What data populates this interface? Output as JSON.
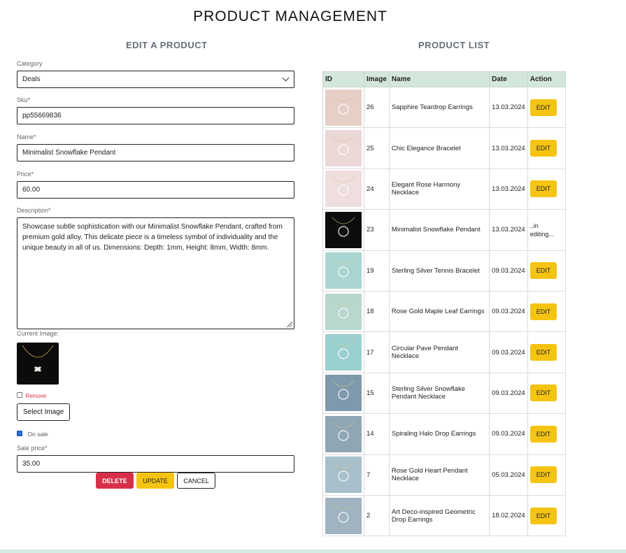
{
  "page": {
    "title": "PRODUCT MANAGEMENT"
  },
  "edit_form": {
    "section_title": "EDIT A PRODUCT",
    "category": {
      "label": "Category",
      "value": "Deals"
    },
    "sku": {
      "label": "Sku*",
      "value": "pp55669836"
    },
    "name": {
      "label": "Name*",
      "value": "Minimalist Snowflake Pendant"
    },
    "price": {
      "label": "Price*",
      "value": "60.00"
    },
    "description": {
      "label": "Description*",
      "value": "Showcase subtle sophistication with our Minimalist Snowflake Pendant, crafted from premium gold alloy. This delicate piece is a timeless symbol of individuality and the unique beauty in all of us. Dimensions: Depth: 1mm, Height: 8mm, Width: 8mm."
    },
    "current_image_label": "Current Image:",
    "remove_label": "Remove",
    "select_image_label": "Select Image",
    "on_sale_label": "On sale",
    "on_sale_checked": true,
    "sale_price": {
      "label": "Sale price*",
      "value": "35.00"
    },
    "buttons": {
      "delete": "DELETE",
      "update": "UPDATE",
      "cancel": "CANCEL"
    }
  },
  "product_list": {
    "section_title": "PRODUCT LIST",
    "columns": [
      "ID",
      "Image",
      "Name",
      "Date",
      "Action"
    ],
    "edit_label": "EDIT",
    "editing_label": "..in editing...",
    "rows": [
      {
        "id": "26",
        "name": "Sapphire Teardrop Earrings",
        "date": "13.03.2024",
        "editing": false,
        "img": "earrings-blue-icon",
        "bg": "#e6cfc7"
      },
      {
        "id": "25",
        "name": "Chic Elegance Bracelet",
        "date": "13.03.2024",
        "editing": false,
        "img": "bracelet-icon",
        "bg": "#ecd7d7"
      },
      {
        "id": "24",
        "name": "Elegant Rose Harmony Necklace",
        "date": "13.03.2024",
        "editing": false,
        "img": "necklace-pink-icon",
        "bg": "#efdede"
      },
      {
        "id": "23",
        "name": "Minimalist Snowflake Pendant",
        "date": "13.03.2024",
        "editing": true,
        "img": "snowflake-pendant-icon",
        "bg": "#0c0c0c"
      },
      {
        "id": "19",
        "name": "Sterling Silver Tennis Bracelet",
        "date": "09.03.2024",
        "editing": false,
        "img": "tennis-bracelet-icon",
        "bg": "#a9d6d2"
      },
      {
        "id": "18",
        "name": "Rose Gold Maple Leaf Earrings",
        "date": "09.03.2024",
        "editing": false,
        "img": "leaf-earrings-icon",
        "bg": "#b8d7ce"
      },
      {
        "id": "17",
        "name": "Circular Pave Pendant Necklace",
        "date": "09.03.2024",
        "editing": false,
        "img": "pave-pendant-icon",
        "bg": "#9ad0cf"
      },
      {
        "id": "15",
        "name": "Sterling Silver Snowflake Pendant Necklace",
        "date": "09.03.2024",
        "editing": false,
        "img": "silver-snowflake-icon",
        "bg": "#7f99ac"
      },
      {
        "id": "14",
        "name": "Spiraling Halo Drop Earrings",
        "date": "09.03.2024",
        "editing": false,
        "img": "halo-earrings-icon",
        "bg": "#8fa6b5"
      },
      {
        "id": "7",
        "name": "Rose Gold Heart Pendant Necklace",
        "date": "05.03.2024",
        "editing": false,
        "img": "heart-pendant-icon",
        "bg": "#a7bfcb"
      },
      {
        "id": "2",
        "name": "Art Deco-inspired Geometric Drop Earrings",
        "date": "18.02.2024",
        "editing": false,
        "img": "deco-earrings-icon",
        "bg": "#9fb3c0"
      }
    ]
  }
}
